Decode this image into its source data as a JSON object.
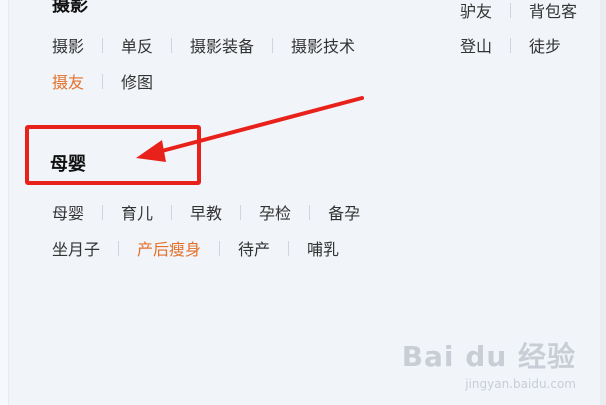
{
  "photography": {
    "title": "摄影",
    "row1": [
      "摄影",
      "单反",
      "摄影装备",
      "摄影技术"
    ],
    "row2": [
      "摄友",
      "修图"
    ],
    "row2_highlight": "摄友"
  },
  "outdoor": {
    "row0": [
      "驴友",
      "背包客"
    ],
    "row1": [
      "登山",
      "徒步"
    ]
  },
  "maternal": {
    "title": "母婴",
    "row1": [
      "母婴",
      "育儿",
      "早教",
      "孕检",
      "备孕"
    ],
    "row2": [
      "坐月子",
      "产后瘦身",
      "待产",
      "哺乳"
    ],
    "row2_highlight": "产后瘦身"
  },
  "watermark": {
    "logo_text": "Bai du 经验",
    "url": "jingyan.baidu.com"
  },
  "colors": {
    "highlight": "#e4712b",
    "annotation": "#e8211b",
    "background": "#f1f4f8"
  }
}
